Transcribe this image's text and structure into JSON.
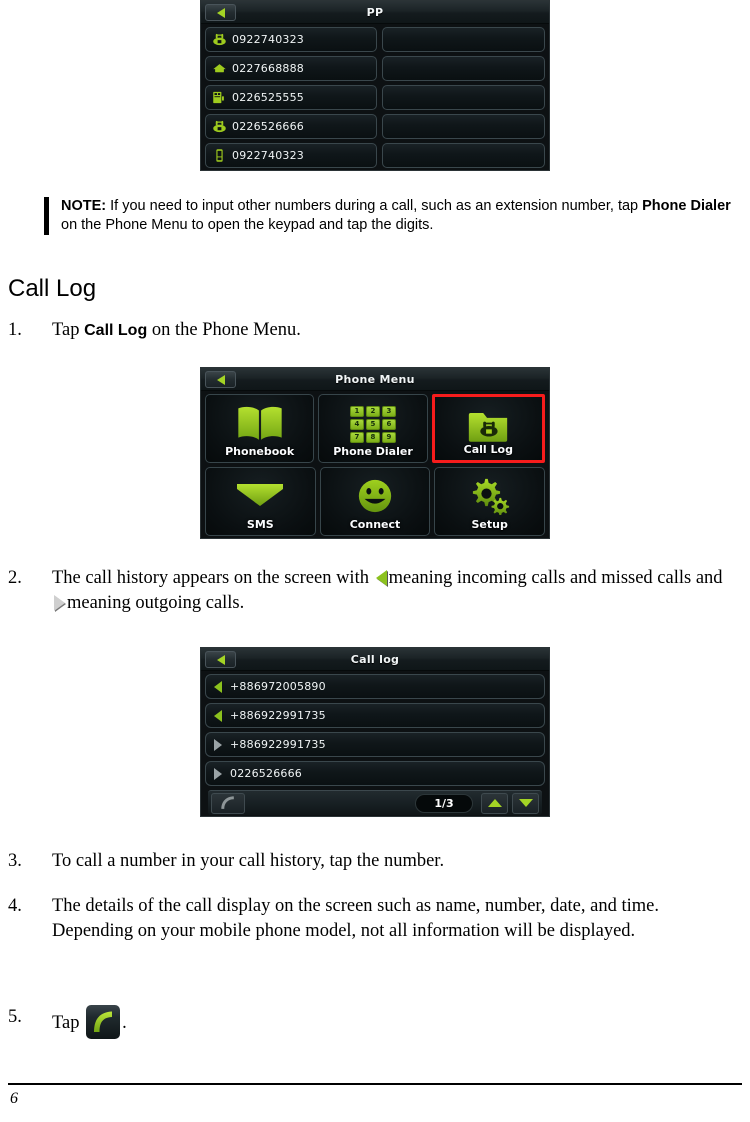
{
  "document": {
    "page_number": "6"
  },
  "phonebook_screen": {
    "title": "PP",
    "back_icon": "back-arrow-icon",
    "rows": [
      {
        "icon": "office-phone-icon",
        "number": "0922740323"
      },
      {
        "icon": "home-icon",
        "number": "0227668888"
      },
      {
        "icon": "fax-icon",
        "number": "0226525555"
      },
      {
        "icon": "office-phone-icon",
        "number": "0226526666"
      },
      {
        "icon": "mobile-phone-icon",
        "number": "0922740323"
      }
    ]
  },
  "note": {
    "label": "NOTE:",
    "text_1": " If you need to input other numbers during a call, such as an extension number, tap ",
    "bold_1": "Phone Dialer",
    "text_2": " on the Phone Menu to open the keypad and tap the digits."
  },
  "section": {
    "heading": "Call Log"
  },
  "steps": {
    "s1": {
      "num": "1.",
      "text_a": "Tap ",
      "bold": "Call Log",
      "text_b": " on the Phone Menu."
    },
    "s2": {
      "num": "2.",
      "text_a": "The call history appears on the screen with ",
      "text_b": "meaning incoming calls and missed calls and ",
      "text_c": "meaning outgoing calls."
    },
    "s3": {
      "num": "3.",
      "text": "To call a number in your call history, tap the number."
    },
    "s4": {
      "num": "4.",
      "text": "The details of the call display on the screen such as name, number, date, and time. Depending on your mobile phone model, not all information will be displayed."
    },
    "s5": {
      "num": "5.",
      "text_a": "Tap ",
      "icon": "call-handset-icon",
      "text_b": "."
    }
  },
  "phone_menu_screen": {
    "title": "Phone Menu",
    "back_icon": "back-arrow-icon",
    "selected_tile": "Call Log",
    "keypad_keys": [
      "1",
      "2",
      "3",
      "4",
      "5",
      "6",
      "7",
      "8",
      "9"
    ],
    "tiles": [
      {
        "label": "Phonebook",
        "icon": "open-book-icon",
        "selected": false
      },
      {
        "label": "Phone Dialer",
        "icon": "keypad-icon",
        "selected": false
      },
      {
        "label": "Call Log",
        "icon": "folder-phone-icon",
        "selected": true
      },
      {
        "label": "SMS",
        "icon": "envelope-icon",
        "selected": false
      },
      {
        "label": "Connect",
        "icon": "smiley-face-icon",
        "selected": false
      },
      {
        "label": "Setup",
        "icon": "gears-icon",
        "selected": false
      }
    ]
  },
  "call_log_screen": {
    "title": "Call log",
    "back_icon": "back-arrow-icon",
    "entries": [
      {
        "direction": "in",
        "number": "+886972005890"
      },
      {
        "direction": "in",
        "number": "+886922991735"
      },
      {
        "direction": "out",
        "number": "+886922991735"
      },
      {
        "direction": "out",
        "number": "0226526666"
      }
    ],
    "footer": {
      "call_icon": "call-handset-icon",
      "page_indicator": "1/3",
      "up_icon": "scroll-up-icon",
      "down_icon": "scroll-down-icon"
    }
  },
  "colors": {
    "accent_green": "#8cc21e",
    "highlight_red": "#f71c1c",
    "screen_bg": "#0d1113"
  }
}
